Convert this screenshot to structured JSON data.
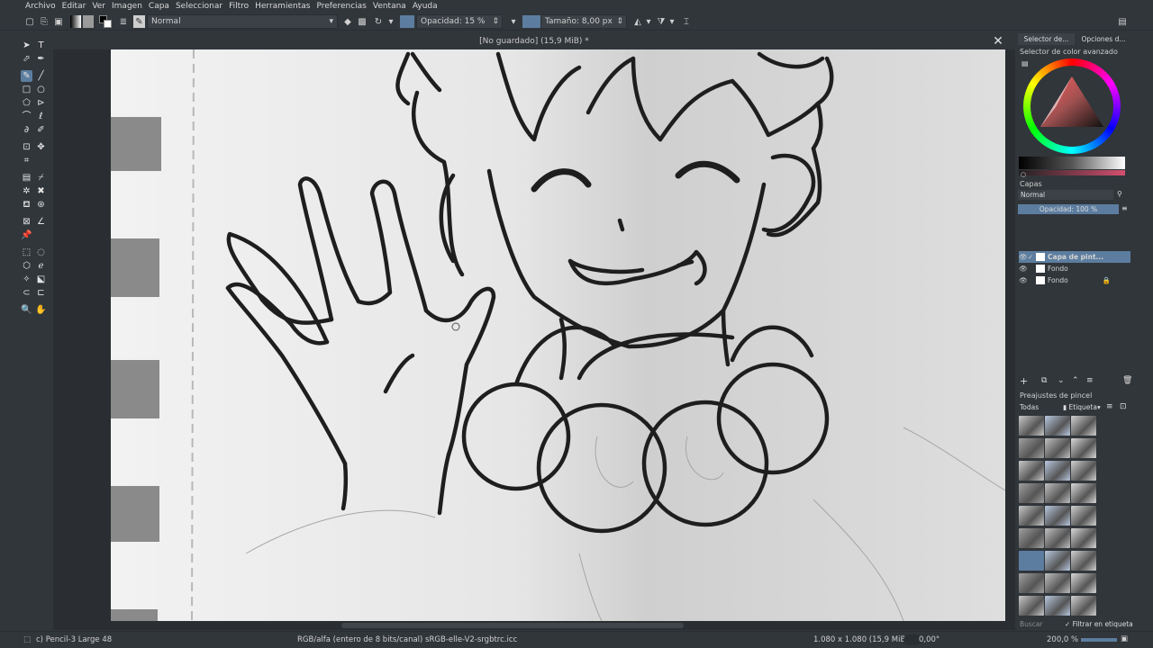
{
  "menu": [
    "Archivo",
    "Editar",
    "Ver",
    "Imagen",
    "Capa",
    "Seleccionar",
    "Filtro",
    "Herramientas",
    "Preferencias",
    "Ventana",
    "Ayuda"
  ],
  "toolbar": {
    "blend_mode": "Normal",
    "opacity": "Opacidad: 15 %",
    "size": "Tamaño: 8,00 px"
  },
  "document": {
    "title": "[No guardado]  (15,9 MiB) *"
  },
  "dockers": {
    "tab1": "Selector de...",
    "tab2": "Opciones d...",
    "color_selector_title": "Selector de color avanzado",
    "layers_title": "Capas",
    "layers_blend": "Normal",
    "layers_opacity": "Opacidad:  100 %",
    "brushes_title": "Preajustes de pincel",
    "brushes_filter": "Todas",
    "brushes_tag": "Etiqueta",
    "search_placeholder": "Buscar",
    "filter_in_tag": "Filtrar en etiqueta"
  },
  "layers": [
    {
      "name": "Capa de pint...",
      "active": true
    },
    {
      "name": "Fondo",
      "active": false
    },
    {
      "name": "Fondo",
      "active": false
    }
  ],
  "status": {
    "brush": "c) Pencil-3 Large 48",
    "color_space": "RGB/alfa (entero de 8 bits/canal)  sRGB-elle-V2-srgbtrc.icc",
    "dimensions": "1.080 x 1.080 (15,9 MiB)",
    "rotation": "0,00°",
    "zoom": "200,0 %"
  },
  "colors": {
    "bg": "#31363b",
    "dark": "#2a2e32",
    "accent": "#5c7d9f",
    "fg_swatch": "#000000",
    "bg_swatch": "#ffffff"
  },
  "icons": [
    "new-document-icon",
    "open-icon",
    "save-icon",
    "eraser-icon",
    "brush-preset-icon",
    "close-icon",
    "mirror-h-icon",
    "mirror-v-icon"
  ]
}
